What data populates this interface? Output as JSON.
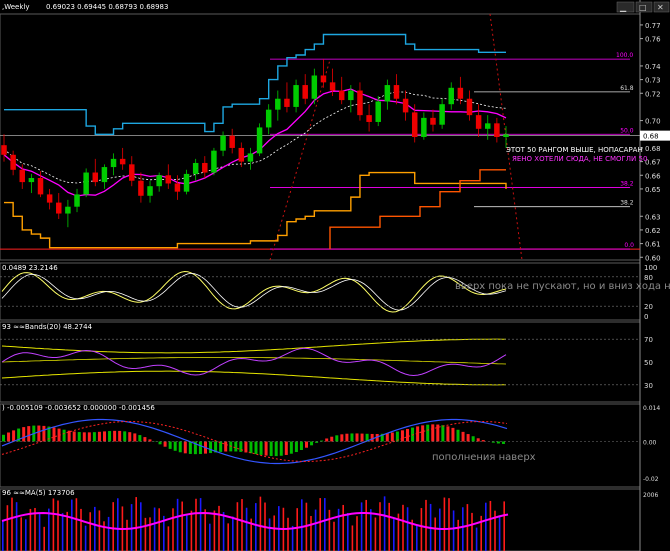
{
  "window": {
    "close_glyph": "✕",
    "min_glyph": "▁",
    "max_glyph": "□"
  },
  "main": {
    "title": ",Weekly",
    "ohlc": "0.69023 0.69445 0.68793 0.68983",
    "price_labels": [
      "0.77",
      "0.76",
      "0.74",
      "0.73",
      "0.72",
      "0.70",
      "0.69",
      "0.68",
      "0.67",
      "0.66",
      "0.65",
      "0.63",
      "0.62",
      "0.61",
      "0.60"
    ],
    "fib_levels": [
      {
        "label": "100.0",
        "value": 0.745
      },
      {
        "label": "61.8",
        "value": 0.721
      },
      {
        "label": "50.0",
        "value": 0.69
      },
      {
        "label": "38.2",
        "value": 0.651
      },
      {
        "label": "38.2",
        "value": 0.637
      },
      {
        "label": "0.0",
        "value": 0.606
      }
    ],
    "current_price": "0.68983",
    "annotation1": "ЭТОТ 50 РАНГОМ ВЫШЕ, НОПАСАРАН",
    "annotation2": "ЯЕНО ХОТЕЛИ СЮДА, НЕ СМОГЛИ 50"
  },
  "stoch": {
    "title": "0.0489 23.2146",
    "axis": [
      "100",
      "80",
      "20",
      "0"
    ],
    "note": "вверх пока не пускают, но и вниз хода нет"
  },
  "rsi": {
    "title": "93  ≈≈Bands(20) 48.2744",
    "axis": [
      "70",
      "50",
      "30"
    ]
  },
  "macd": {
    "title": ") -0.005109 -0.003652 0.000000 -0.001456",
    "axis": [
      "0.014",
      "0.00",
      "-0.02"
    ],
    "note": "пополнения наверх"
  },
  "volume": {
    "title": "96  ≈≈MA(5) 173706",
    "axis": [
      "2006"
    ]
  },
  "colors": {
    "bull": "#00cc00",
    "bear": "#ee0000",
    "bands": "#1ea7e1",
    "magenta": "#ff00ff",
    "orange": "#ffa000",
    "grid": "#4a4a4a",
    "volume_up": "#1a1aff"
  },
  "chart_data": {
    "type": "candlestick",
    "price_range": [
      0.598,
      0.778
    ],
    "candles": [
      {
        "o": 0.682,
        "h": 0.69,
        "l": 0.67,
        "c": 0.675
      },
      {
        "o": 0.675,
        "h": 0.678,
        "l": 0.66,
        "c": 0.664
      },
      {
        "o": 0.664,
        "h": 0.668,
        "l": 0.65,
        "c": 0.655
      },
      {
        "o": 0.655,
        "h": 0.661,
        "l": 0.647,
        "c": 0.658
      },
      {
        "o": 0.658,
        "h": 0.663,
        "l": 0.644,
        "c": 0.646
      },
      {
        "o": 0.646,
        "h": 0.65,
        "l": 0.635,
        "c": 0.64
      },
      {
        "o": 0.64,
        "h": 0.647,
        "l": 0.628,
        "c": 0.632
      },
      {
        "o": 0.632,
        "h": 0.642,
        "l": 0.622,
        "c": 0.637
      },
      {
        "o": 0.637,
        "h": 0.65,
        "l": 0.633,
        "c": 0.646
      },
      {
        "o": 0.646,
        "h": 0.665,
        "l": 0.644,
        "c": 0.662
      },
      {
        "o": 0.662,
        "h": 0.672,
        "l": 0.652,
        "c": 0.655
      },
      {
        "o": 0.655,
        "h": 0.668,
        "l": 0.65,
        "c": 0.666
      },
      {
        "o": 0.666,
        "h": 0.676,
        "l": 0.66,
        "c": 0.672
      },
      {
        "o": 0.672,
        "h": 0.68,
        "l": 0.664,
        "c": 0.668
      },
      {
        "o": 0.668,
        "h": 0.674,
        "l": 0.652,
        "c": 0.656
      },
      {
        "o": 0.656,
        "h": 0.662,
        "l": 0.64,
        "c": 0.645
      },
      {
        "o": 0.645,
        "h": 0.656,
        "l": 0.64,
        "c": 0.652
      },
      {
        "o": 0.652,
        "h": 0.662,
        "l": 0.648,
        "c": 0.66
      },
      {
        "o": 0.66,
        "h": 0.668,
        "l": 0.65,
        "c": 0.654
      },
      {
        "o": 0.654,
        "h": 0.66,
        "l": 0.642,
        "c": 0.648
      },
      {
        "o": 0.648,
        "h": 0.664,
        "l": 0.646,
        "c": 0.661
      },
      {
        "o": 0.661,
        "h": 0.672,
        "l": 0.656,
        "c": 0.669
      },
      {
        "o": 0.669,
        "h": 0.674,
        "l": 0.658,
        "c": 0.662
      },
      {
        "o": 0.662,
        "h": 0.68,
        "l": 0.66,
        "c": 0.678
      },
      {
        "o": 0.678,
        "h": 0.692,
        "l": 0.674,
        "c": 0.689
      },
      {
        "o": 0.689,
        "h": 0.694,
        "l": 0.676,
        "c": 0.68
      },
      {
        "o": 0.68,
        "h": 0.684,
        "l": 0.666,
        "c": 0.67
      },
      {
        "o": 0.67,
        "h": 0.68,
        "l": 0.664,
        "c": 0.676
      },
      {
        "o": 0.676,
        "h": 0.698,
        "l": 0.674,
        "c": 0.695
      },
      {
        "o": 0.695,
        "h": 0.712,
        "l": 0.69,
        "c": 0.708
      },
      {
        "o": 0.708,
        "h": 0.722,
        "l": 0.7,
        "c": 0.716
      },
      {
        "o": 0.716,
        "h": 0.728,
        "l": 0.706,
        "c": 0.71
      },
      {
        "o": 0.71,
        "h": 0.73,
        "l": 0.706,
        "c": 0.726
      },
      {
        "o": 0.726,
        "h": 0.734,
        "l": 0.712,
        "c": 0.716
      },
      {
        "o": 0.716,
        "h": 0.738,
        "l": 0.712,
        "c": 0.733
      },
      {
        "o": 0.733,
        "h": 0.745,
        "l": 0.724,
        "c": 0.728
      },
      {
        "o": 0.728,
        "h": 0.738,
        "l": 0.718,
        "c": 0.722
      },
      {
        "o": 0.722,
        "h": 0.732,
        "l": 0.712,
        "c": 0.715
      },
      {
        "o": 0.715,
        "h": 0.726,
        "l": 0.706,
        "c": 0.722
      },
      {
        "o": 0.722,
        "h": 0.728,
        "l": 0.7,
        "c": 0.704
      },
      {
        "o": 0.704,
        "h": 0.712,
        "l": 0.692,
        "c": 0.699
      },
      {
        "o": 0.699,
        "h": 0.718,
        "l": 0.696,
        "c": 0.714
      },
      {
        "o": 0.714,
        "h": 0.73,
        "l": 0.708,
        "c": 0.726
      },
      {
        "o": 0.726,
        "h": 0.734,
        "l": 0.712,
        "c": 0.716
      },
      {
        "o": 0.716,
        "h": 0.722,
        "l": 0.7,
        "c": 0.706
      },
      {
        "o": 0.706,
        "h": 0.712,
        "l": 0.684,
        "c": 0.688
      },
      {
        "o": 0.688,
        "h": 0.706,
        "l": 0.686,
        "c": 0.702
      },
      {
        "o": 0.702,
        "h": 0.708,
        "l": 0.692,
        "c": 0.697
      },
      {
        "o": 0.697,
        "h": 0.716,
        "l": 0.694,
        "c": 0.712
      },
      {
        "o": 0.712,
        "h": 0.728,
        "l": 0.708,
        "c": 0.724
      },
      {
        "o": 0.724,
        "h": 0.732,
        "l": 0.712,
        "c": 0.716
      },
      {
        "o": 0.716,
        "h": 0.722,
        "l": 0.7,
        "c": 0.704
      },
      {
        "o": 0.704,
        "h": 0.712,
        "l": 0.688,
        "c": 0.694
      },
      {
        "o": 0.694,
        "h": 0.704,
        "l": 0.686,
        "c": 0.698
      },
      {
        "o": 0.698,
        "h": 0.702,
        "l": 0.684,
        "c": 0.688
      },
      {
        "o": 0.688,
        "h": 0.696,
        "l": 0.68,
        "c": 0.69
      }
    ]
  }
}
